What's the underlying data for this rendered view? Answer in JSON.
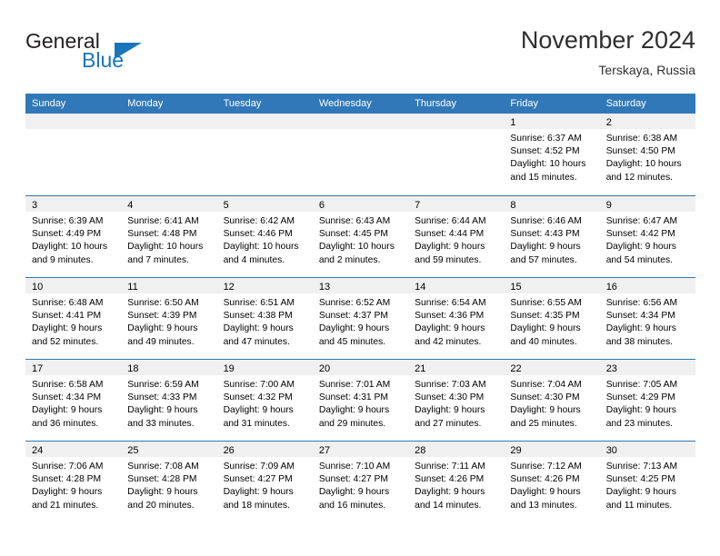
{
  "brand": {
    "name_part1": "General",
    "name_part2": "Blue",
    "accent_color": "#1b75bb",
    "logo_icon": "triangle-flag-icon"
  },
  "header": {
    "title": "November 2024",
    "subtitle": "Terskaya, Russia",
    "header_bg": "#3178b8",
    "band_bg": "#f0f0f0"
  },
  "weekdays": [
    "Sunday",
    "Monday",
    "Tuesday",
    "Wednesday",
    "Thursday",
    "Friday",
    "Saturday"
  ],
  "weeks": [
    [
      {
        "day": "",
        "lines": []
      },
      {
        "day": "",
        "lines": []
      },
      {
        "day": "",
        "lines": []
      },
      {
        "day": "",
        "lines": []
      },
      {
        "day": "",
        "lines": []
      },
      {
        "day": "1",
        "lines": [
          "Sunrise: 6:37 AM",
          "Sunset: 4:52 PM",
          "Daylight: 10 hours",
          "and 15 minutes."
        ]
      },
      {
        "day": "2",
        "lines": [
          "Sunrise: 6:38 AM",
          "Sunset: 4:50 PM",
          "Daylight: 10 hours",
          "and 12 minutes."
        ]
      }
    ],
    [
      {
        "day": "3",
        "lines": [
          "Sunrise: 6:39 AM",
          "Sunset: 4:49 PM",
          "Daylight: 10 hours",
          "and 9 minutes."
        ]
      },
      {
        "day": "4",
        "lines": [
          "Sunrise: 6:41 AM",
          "Sunset: 4:48 PM",
          "Daylight: 10 hours",
          "and 7 minutes."
        ]
      },
      {
        "day": "5",
        "lines": [
          "Sunrise: 6:42 AM",
          "Sunset: 4:46 PM",
          "Daylight: 10 hours",
          "and 4 minutes."
        ]
      },
      {
        "day": "6",
        "lines": [
          "Sunrise: 6:43 AM",
          "Sunset: 4:45 PM",
          "Daylight: 10 hours",
          "and 2 minutes."
        ]
      },
      {
        "day": "7",
        "lines": [
          "Sunrise: 6:44 AM",
          "Sunset: 4:44 PM",
          "Daylight: 9 hours",
          "and 59 minutes."
        ]
      },
      {
        "day": "8",
        "lines": [
          "Sunrise: 6:46 AM",
          "Sunset: 4:43 PM",
          "Daylight: 9 hours",
          "and 57 minutes."
        ]
      },
      {
        "day": "9",
        "lines": [
          "Sunrise: 6:47 AM",
          "Sunset: 4:42 PM",
          "Daylight: 9 hours",
          "and 54 minutes."
        ]
      }
    ],
    [
      {
        "day": "10",
        "lines": [
          "Sunrise: 6:48 AM",
          "Sunset: 4:41 PM",
          "Daylight: 9 hours",
          "and 52 minutes."
        ]
      },
      {
        "day": "11",
        "lines": [
          "Sunrise: 6:50 AM",
          "Sunset: 4:39 PM",
          "Daylight: 9 hours",
          "and 49 minutes."
        ]
      },
      {
        "day": "12",
        "lines": [
          "Sunrise: 6:51 AM",
          "Sunset: 4:38 PM",
          "Daylight: 9 hours",
          "and 47 minutes."
        ]
      },
      {
        "day": "13",
        "lines": [
          "Sunrise: 6:52 AM",
          "Sunset: 4:37 PM",
          "Daylight: 9 hours",
          "and 45 minutes."
        ]
      },
      {
        "day": "14",
        "lines": [
          "Sunrise: 6:54 AM",
          "Sunset: 4:36 PM",
          "Daylight: 9 hours",
          "and 42 minutes."
        ]
      },
      {
        "day": "15",
        "lines": [
          "Sunrise: 6:55 AM",
          "Sunset: 4:35 PM",
          "Daylight: 9 hours",
          "and 40 minutes."
        ]
      },
      {
        "day": "16",
        "lines": [
          "Sunrise: 6:56 AM",
          "Sunset: 4:34 PM",
          "Daylight: 9 hours",
          "and 38 minutes."
        ]
      }
    ],
    [
      {
        "day": "17",
        "lines": [
          "Sunrise: 6:58 AM",
          "Sunset: 4:34 PM",
          "Daylight: 9 hours",
          "and 36 minutes."
        ]
      },
      {
        "day": "18",
        "lines": [
          "Sunrise: 6:59 AM",
          "Sunset: 4:33 PM",
          "Daylight: 9 hours",
          "and 33 minutes."
        ]
      },
      {
        "day": "19",
        "lines": [
          "Sunrise: 7:00 AM",
          "Sunset: 4:32 PM",
          "Daylight: 9 hours",
          "and 31 minutes."
        ]
      },
      {
        "day": "20",
        "lines": [
          "Sunrise: 7:01 AM",
          "Sunset: 4:31 PM",
          "Daylight: 9 hours",
          "and 29 minutes."
        ]
      },
      {
        "day": "21",
        "lines": [
          "Sunrise: 7:03 AM",
          "Sunset: 4:30 PM",
          "Daylight: 9 hours",
          "and 27 minutes."
        ]
      },
      {
        "day": "22",
        "lines": [
          "Sunrise: 7:04 AM",
          "Sunset: 4:30 PM",
          "Daylight: 9 hours",
          "and 25 minutes."
        ]
      },
      {
        "day": "23",
        "lines": [
          "Sunrise: 7:05 AM",
          "Sunset: 4:29 PM",
          "Daylight: 9 hours",
          "and 23 minutes."
        ]
      }
    ],
    [
      {
        "day": "24",
        "lines": [
          "Sunrise: 7:06 AM",
          "Sunset: 4:28 PM",
          "Daylight: 9 hours",
          "and 21 minutes."
        ]
      },
      {
        "day": "25",
        "lines": [
          "Sunrise: 7:08 AM",
          "Sunset: 4:28 PM",
          "Daylight: 9 hours",
          "and 20 minutes."
        ]
      },
      {
        "day": "26",
        "lines": [
          "Sunrise: 7:09 AM",
          "Sunset: 4:27 PM",
          "Daylight: 9 hours",
          "and 18 minutes."
        ]
      },
      {
        "day": "27",
        "lines": [
          "Sunrise: 7:10 AM",
          "Sunset: 4:27 PM",
          "Daylight: 9 hours",
          "and 16 minutes."
        ]
      },
      {
        "day": "28",
        "lines": [
          "Sunrise: 7:11 AM",
          "Sunset: 4:26 PM",
          "Daylight: 9 hours",
          "and 14 minutes."
        ]
      },
      {
        "day": "29",
        "lines": [
          "Sunrise: 7:12 AM",
          "Sunset: 4:26 PM",
          "Daylight: 9 hours",
          "and 13 minutes."
        ]
      },
      {
        "day": "30",
        "lines": [
          "Sunrise: 7:13 AM",
          "Sunset: 4:25 PM",
          "Daylight: 9 hours",
          "and 11 minutes."
        ]
      }
    ]
  ]
}
